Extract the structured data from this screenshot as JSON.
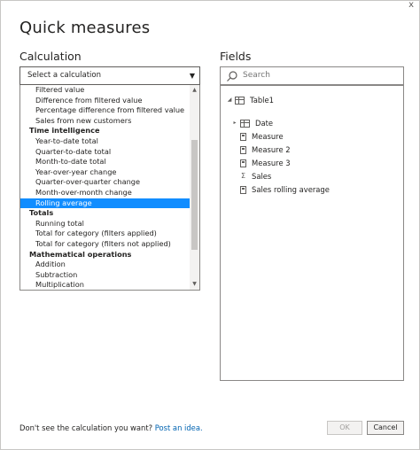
{
  "dialog": {
    "title": "Quick measures",
    "close_glyph": "x"
  },
  "calculation": {
    "label": "Calculation",
    "select_placeholder": "Select a calculation",
    "items": [
      {
        "text": "Filtered value",
        "type": "item"
      },
      {
        "text": "Difference from filtered value",
        "type": "item"
      },
      {
        "text": "Percentage difference from filtered value",
        "type": "item"
      },
      {
        "text": "Sales from new customers",
        "type": "item"
      },
      {
        "text": "Time intelligence",
        "type": "group"
      },
      {
        "text": "Year-to-date total",
        "type": "item"
      },
      {
        "text": "Quarter-to-date total",
        "type": "item"
      },
      {
        "text": "Month-to-date total",
        "type": "item"
      },
      {
        "text": "Year-over-year change",
        "type": "item"
      },
      {
        "text": "Quarter-over-quarter change",
        "type": "item"
      },
      {
        "text": "Month-over-month change",
        "type": "item"
      },
      {
        "text": "Rolling average",
        "type": "item",
        "selected": true
      },
      {
        "text": "Totals",
        "type": "group"
      },
      {
        "text": "Running total",
        "type": "item"
      },
      {
        "text": "Total for category (filters applied)",
        "type": "item"
      },
      {
        "text": "Total for category (filters not applied)",
        "type": "item"
      },
      {
        "text": "Mathematical operations",
        "type": "group"
      },
      {
        "text": "Addition",
        "type": "item"
      },
      {
        "text": "Subtraction",
        "type": "item"
      },
      {
        "text": "Multiplication",
        "type": "item"
      }
    ]
  },
  "fields": {
    "label": "Fields",
    "search_placeholder": "Search",
    "tree": {
      "table_name": "Table1",
      "rows": [
        {
          "text": "Date",
          "icon": "table-icon",
          "expandable": true
        },
        {
          "text": "Measure",
          "icon": "calculator-icon"
        },
        {
          "text": "Measure 2",
          "icon": "calculator-icon"
        },
        {
          "text": "Measure 3",
          "icon": "calculator-icon"
        },
        {
          "text": "Sales",
          "icon": "sigma-icon"
        },
        {
          "text": "Sales rolling average",
          "icon": "calculator-icon"
        }
      ]
    }
  },
  "footer": {
    "prompt": "Don't see the calculation you want?",
    "link_text": "Post an idea.",
    "ok_label": "OK",
    "cancel_label": "Cancel"
  },
  "colors": {
    "selection": "#118dff",
    "link": "#0063b1"
  }
}
